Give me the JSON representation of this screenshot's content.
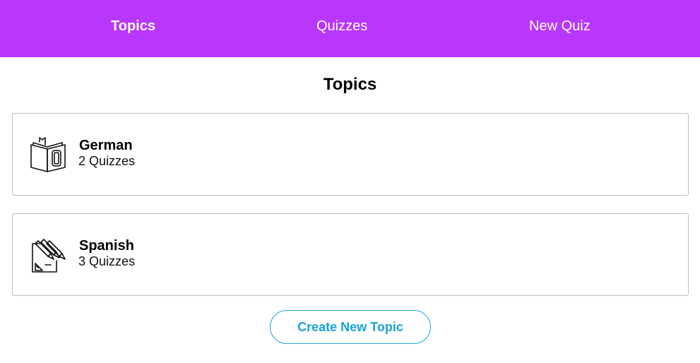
{
  "nav": {
    "items": [
      {
        "label": "Topics",
        "active": true
      },
      {
        "label": "Quizzes",
        "active": false
      },
      {
        "label": "New Quiz",
        "active": false
      }
    ]
  },
  "page": {
    "title": "Topics"
  },
  "topics": [
    {
      "name": "German",
      "count": "2 Quizzes",
      "icon": "book-icon"
    },
    {
      "name": "Spanish",
      "count": "3 Quizzes",
      "icon": "pencils-icon"
    }
  ],
  "actions": {
    "create_label": "Create New Topic"
  },
  "colors": {
    "nav_background": "#b936fc",
    "nav_text": "#ffffff",
    "accent": "#1aa4d6",
    "card_border": "#bdbdbd"
  }
}
